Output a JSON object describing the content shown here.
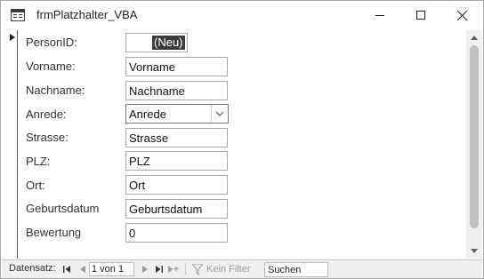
{
  "window": {
    "title": "frmPlatzhalter_VBA",
    "icon": "form-icon",
    "controls": [
      "minimize-icon",
      "maximize-icon",
      "close-icon"
    ]
  },
  "form": {
    "fields": {
      "personid": {
        "label": "PersonID:",
        "value": "(Neu)"
      },
      "vorname": {
        "label": "Vorname:",
        "value": "Vorname"
      },
      "nachname": {
        "label": "Nachname:",
        "value": "Nachname"
      },
      "anrede": {
        "label": "Anrede:",
        "value": "Anrede"
      },
      "strasse": {
        "label": "Strasse:",
        "value": "Strasse"
      },
      "plz": {
        "label": "PLZ:",
        "value": "PLZ"
      },
      "ort": {
        "label": "Ort:",
        "value": "Ort"
      },
      "geburtsdatum": {
        "label": "Geburtsdatum",
        "value": "Geburtsdatum"
      },
      "bewertung": {
        "label": "Bewertung",
        "value": "0"
      }
    }
  },
  "navbar": {
    "label": "Datensatz:",
    "position": "1 von 1",
    "filter": "Kein Filter",
    "search": "Suchen"
  },
  "colors": {
    "selection": "#3b3b3b",
    "scroll_thumb": "#c1c1c1",
    "navbar_bg": "#f0f0f0"
  }
}
